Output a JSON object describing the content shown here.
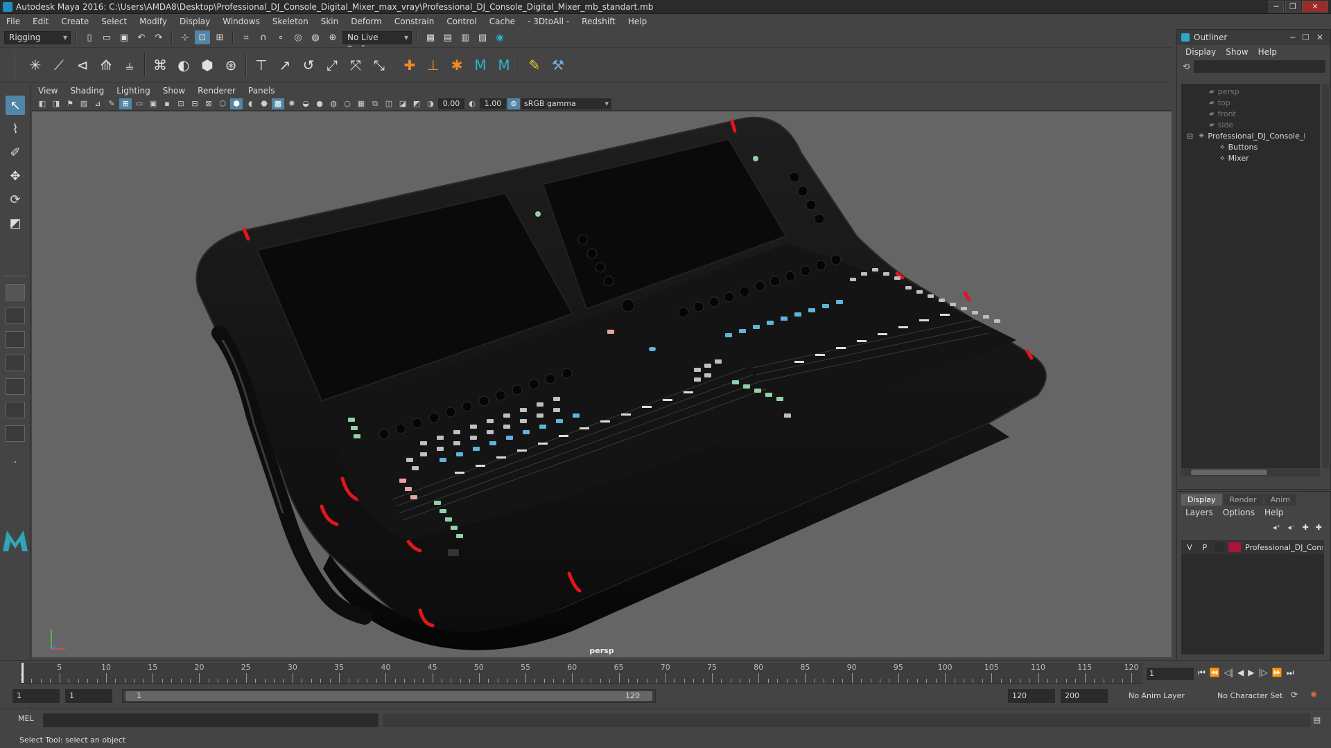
{
  "window": {
    "title": "Autodesk Maya 2016: C:\\Users\\AMDA8\\Desktop\\Professional_DJ_Console_Digital_Mixer_max_vray\\Professional_DJ_Console_Digital_Mixer_mb_standart.mb"
  },
  "menubar": [
    "File",
    "Edit",
    "Create",
    "Select",
    "Modify",
    "Display",
    "Windows",
    "Skeleton",
    "Skin",
    "Deform",
    "Constrain",
    "Control",
    "Cache",
    "- 3DtoAll -",
    "Redshift",
    "Help"
  ],
  "status_toolbar": {
    "menu_set": "Rigging",
    "live_surface": "No Live Surface"
  },
  "viewport": {
    "menu": [
      "View",
      "Shading",
      "Lighting",
      "Show",
      "Renderer",
      "Panels"
    ],
    "exposure": "0.00",
    "gamma": "1.00",
    "color_space": "sRGB gamma",
    "camera_label": "persp"
  },
  "outliner": {
    "title": "Outliner",
    "menu": [
      "Display",
      "Show",
      "Help"
    ],
    "items": [
      {
        "label": "persp",
        "type": "camera"
      },
      {
        "label": "top",
        "type": "camera"
      },
      {
        "label": "front",
        "type": "camera"
      },
      {
        "label": "side",
        "type": "camera"
      },
      {
        "label": "Professional_DJ_Console_Digital_Mixer",
        "type": "group"
      },
      {
        "label": "Buttons",
        "type": "mesh"
      },
      {
        "label": "Mixer",
        "type": "mesh"
      }
    ]
  },
  "layer_editor": {
    "tabs": [
      "Display",
      "Render",
      "Anim"
    ],
    "active_tab": "Display",
    "menu": [
      "Layers",
      "Options",
      "Help"
    ],
    "layers": [
      {
        "visible": "V",
        "playback": "P",
        "name": "Professional_DJ_Console_Digital_Mixer",
        "color": "#a9143c"
      }
    ]
  },
  "time_slider": {
    "ticks": [
      1,
      5,
      10,
      15,
      20,
      25,
      30,
      35,
      40,
      45,
      50,
      55,
      60,
      65,
      70,
      75,
      80,
      85,
      90,
      95,
      100,
      105,
      110,
      115,
      120
    ],
    "current_frame": "1"
  },
  "range_slider": {
    "start_time": "1",
    "playback_start": "1",
    "range_start": "1",
    "range_end": "120",
    "playback_end": "120",
    "end_time": "200",
    "anim_layer": "No Anim Layer",
    "character_set": "No Character Set"
  },
  "command_line": {
    "label": "MEL"
  },
  "help_line": "Select Tool: select an object",
  "colors": {
    "accent": "#5285a6",
    "viewport_bg": "#656565",
    "layer_color": "#a9143c",
    "handle_red": "#e0161e"
  }
}
